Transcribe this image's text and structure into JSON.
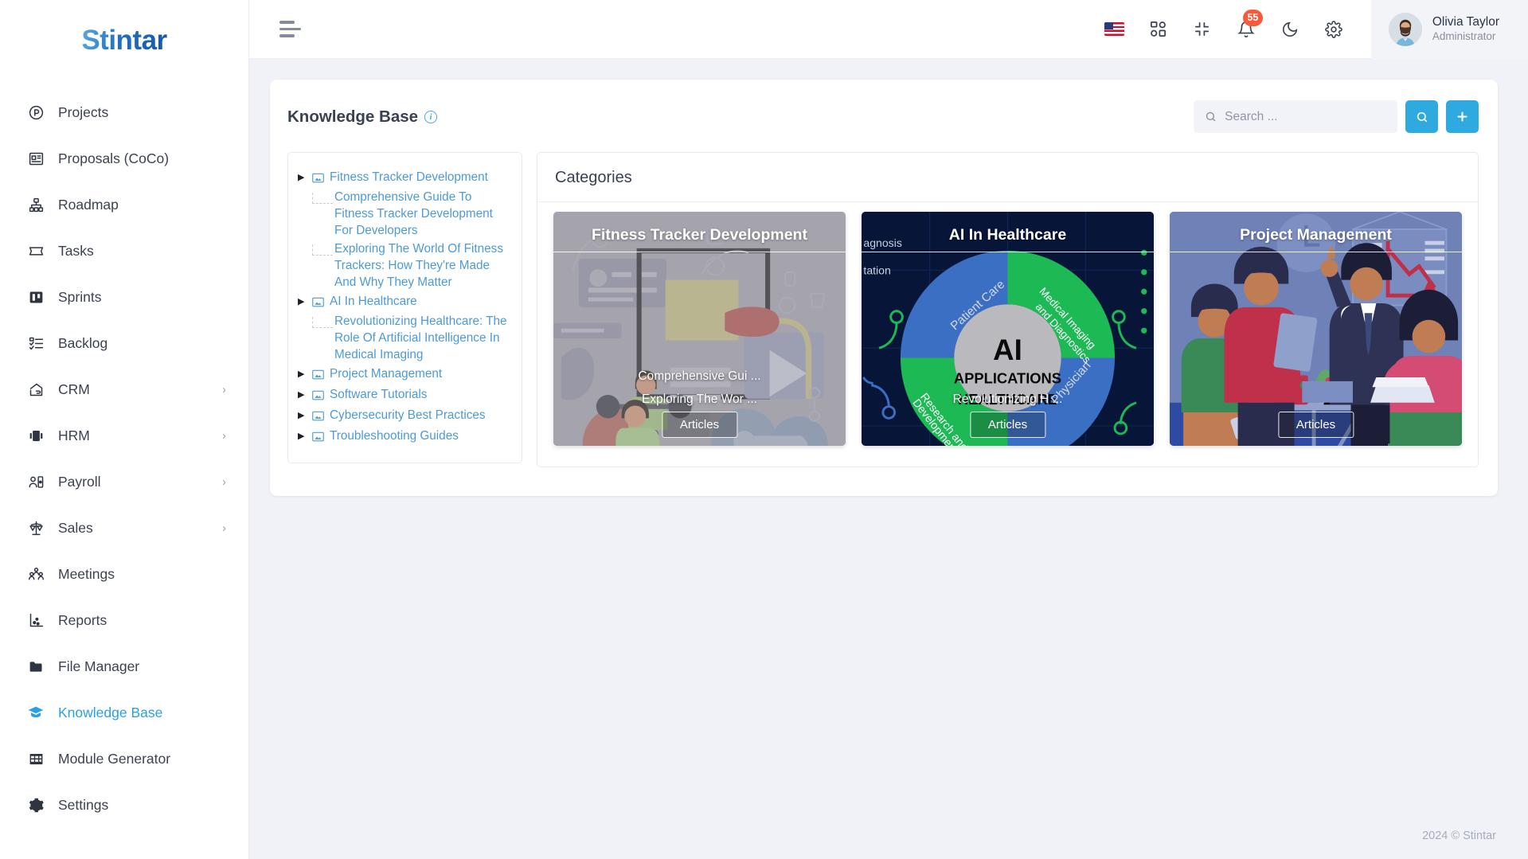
{
  "brand": {
    "name": "Stintar"
  },
  "sidebar": {
    "items": [
      {
        "label": "Projects",
        "icon": "projects-icon",
        "expandable": false,
        "active": false
      },
      {
        "label": "Proposals (CoCo)",
        "icon": "proposals-icon",
        "expandable": false,
        "active": false
      },
      {
        "label": "Roadmap",
        "icon": "roadmap-icon",
        "expandable": false,
        "active": false
      },
      {
        "label": "Tasks",
        "icon": "tasks-icon",
        "expandable": false,
        "active": false
      },
      {
        "label": "Sprints",
        "icon": "sprints-icon",
        "expandable": false,
        "active": false
      },
      {
        "label": "Backlog",
        "icon": "backlog-icon",
        "expandable": false,
        "active": false
      },
      {
        "label": "CRM",
        "icon": "crm-icon",
        "expandable": true,
        "active": false
      },
      {
        "label": "HRM",
        "icon": "hrm-icon",
        "expandable": true,
        "active": false
      },
      {
        "label": "Payroll",
        "icon": "payroll-icon",
        "expandable": true,
        "active": false
      },
      {
        "label": "Sales",
        "icon": "sales-icon",
        "expandable": true,
        "active": false
      },
      {
        "label": "Meetings",
        "icon": "meetings-icon",
        "expandable": false,
        "active": false
      },
      {
        "label": "Reports",
        "icon": "reports-icon",
        "expandable": false,
        "active": false
      },
      {
        "label": "File Manager",
        "icon": "folder-icon",
        "expandable": false,
        "active": false
      },
      {
        "label": "Knowledge Base",
        "icon": "graduation-cap-icon",
        "expandable": false,
        "active": true
      },
      {
        "label": "Module Generator",
        "icon": "grid-table-icon",
        "expandable": false,
        "active": false
      },
      {
        "label": "Settings",
        "icon": "gear-icon",
        "expandable": false,
        "active": false
      }
    ],
    "chevron": "›"
  },
  "topbar": {
    "menu_toggle": "hamburger-icon",
    "icons": [
      "flag-us-icon",
      "apps-grid-icon",
      "collapse-screen-icon",
      "bell-icon",
      "moon-icon",
      "gear-icon"
    ],
    "notification_count": "55",
    "user": {
      "name": "Olivia Taylor",
      "role": "Administrator"
    }
  },
  "page": {
    "title": "Knowledge Base",
    "info_glyph": "i"
  },
  "search": {
    "placeholder": "Search ...",
    "value": "",
    "search_button": "search-icon",
    "add_button": "+"
  },
  "tree": {
    "nodes": [
      {
        "label": "Fitness Tracker Development",
        "children": [
          "Comprehensive Guide To Fitness Tracker Development For Developers",
          "Exploring The World Of Fitness Trackers: How They're Made And Why They Matter"
        ]
      },
      {
        "label": "AI In Healthcare",
        "children": [
          "Revolutionizing Healthcare: The Role Of Artificial Intelligence In Medical Imaging"
        ]
      },
      {
        "label": "Project Management",
        "children": []
      },
      {
        "label": "Software Tutorials",
        "children": []
      },
      {
        "label": "Cybersecurity Best Practices",
        "children": []
      },
      {
        "label": "Troubleshooting Guides",
        "children": []
      }
    ],
    "caret": "▶"
  },
  "categories": {
    "heading": "Categories",
    "tiles": [
      {
        "title": "Fitness Tracker Development",
        "links": [
          "Comprehensive Gui ...",
          "Exploring The Wor ..."
        ],
        "button": "Articles",
        "theme": "fitness",
        "bg_color": "#a9a9b4"
      },
      {
        "title": "AI In Healthcare",
        "links": [
          "Revolutionizing H ..."
        ],
        "button": "Articles",
        "theme": "ai-healthcare",
        "bg_color": "#071538",
        "donut": {
          "center_lines": [
            "AI",
            "APPLICATIONS",
            "HEALTHCARE"
          ],
          "segments": [
            {
              "label": "Patient Care",
              "color": "#3b6fc4"
            },
            {
              "label": "Medical Imaging and Diagnostics",
              "color": "#1db954"
            },
            {
              "label": "Physician",
              "color": "#3b6fc4"
            },
            {
              "label": "Research and Development",
              "color": "#1db954"
            }
          ],
          "side_labels": [
            "agnosis",
            "tation"
          ]
        }
      },
      {
        "title": "Project Management",
        "links": [],
        "button": "Articles",
        "theme": "project",
        "bg_color": "#2f4aa3"
      }
    ]
  },
  "footer": {
    "text": "2024 © Stintar"
  }
}
